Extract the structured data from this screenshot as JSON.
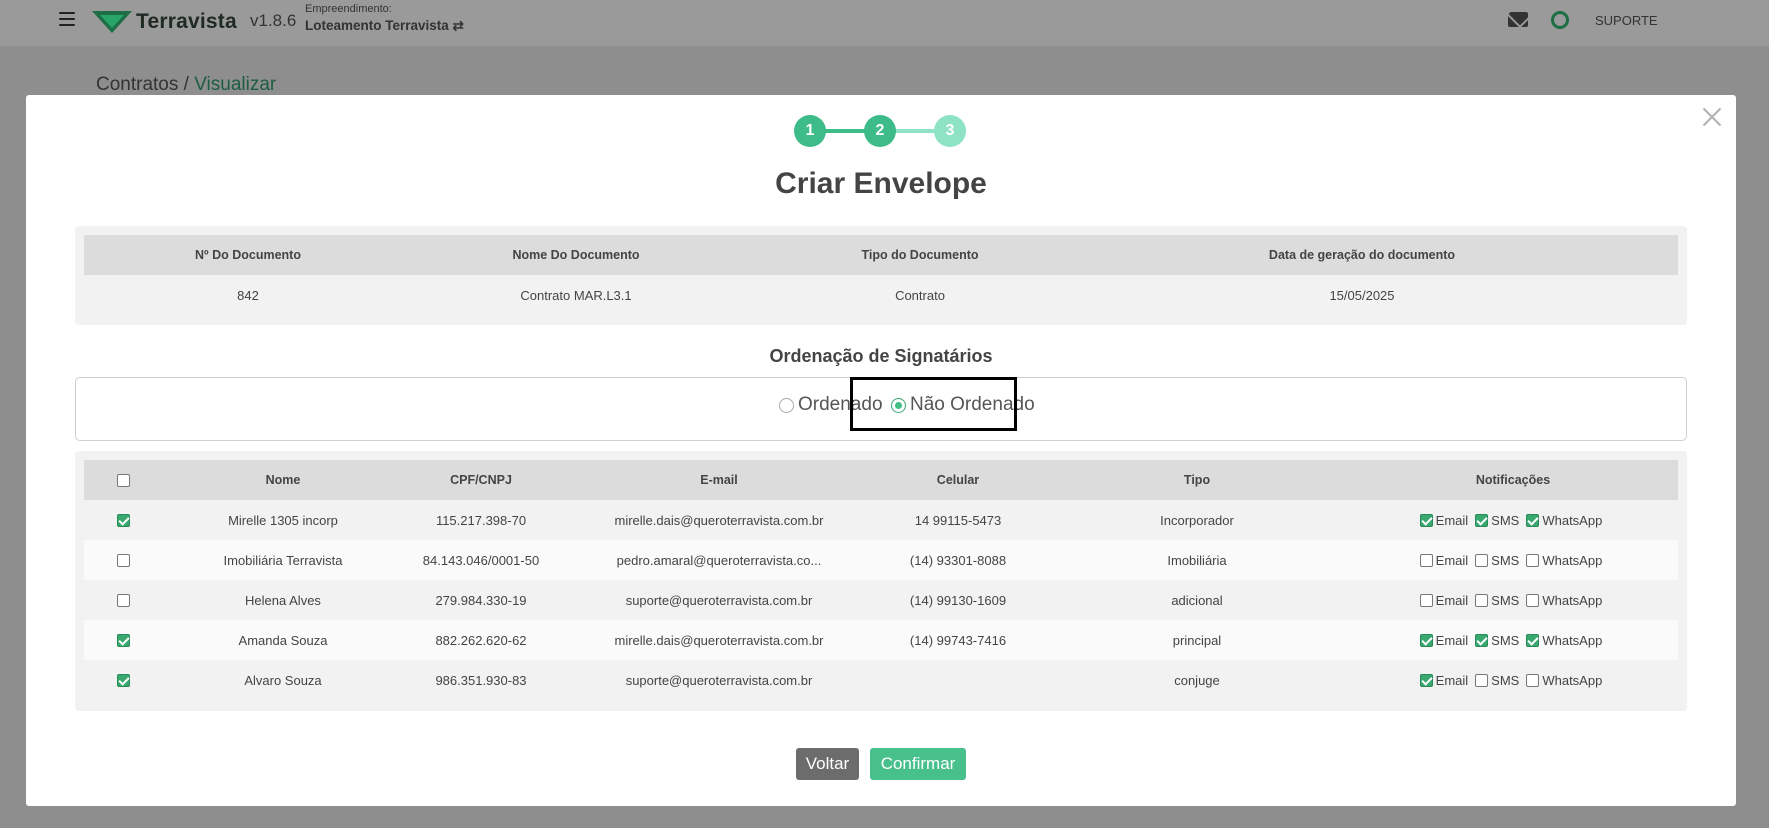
{
  "app": {
    "brand": "Terravista",
    "version": "v1.8.6",
    "enterprise_label": "Empreendimento:",
    "enterprise_value": "Loteamento Terravista ⇄",
    "support_label": "SUPORTE",
    "brand_color": "#1d6e45"
  },
  "breadcrumb": {
    "root": "Contratos",
    "separator": " / ",
    "current": "Visualizar"
  },
  "modal": {
    "steps": [
      "1",
      "2",
      "3"
    ],
    "current_step": 2,
    "title": "Criar Envelope"
  },
  "document_table": {
    "headers": [
      "Nº Do Documento",
      "Nome Do Documento",
      "Tipo do Documento",
      "Data de geração do documento"
    ],
    "row": [
      "842",
      "Contrato MAR.L3.1",
      "Contrato",
      "15/05/2025"
    ]
  },
  "ordering": {
    "title": "Ordenação de Signatários",
    "options": [
      {
        "label": "Ordenado",
        "selected": false
      },
      {
        "label": "Não Ordenado",
        "selected": true
      }
    ]
  },
  "signers_table": {
    "headers": [
      "Nome",
      "CPF/CNPJ",
      "E-mail",
      "Celular",
      "Tipo",
      "Notificações"
    ],
    "notification_labels": [
      "Email",
      "SMS",
      "WhatsApp"
    ],
    "rows": [
      {
        "selected": true,
        "name": "Mirelle 1305 incorp",
        "doc": "115.217.398-70",
        "email": "mirelle.dais@queroterravista.com.br",
        "phone": "14 99115-5473",
        "type": "Incorporador",
        "notifications": [
          true,
          true,
          true
        ]
      },
      {
        "selected": false,
        "name": "Imobiliária Terravista",
        "doc": "84.143.046/0001-50",
        "email": "pedro.amaral@queroterravista.co...",
        "phone": "(14) 93301-8088",
        "type": "Imobiliária",
        "notifications": [
          false,
          false,
          false
        ]
      },
      {
        "selected": false,
        "name": "Helena Alves",
        "doc": "279.984.330-19",
        "email": "suporte@queroterravista.com.br",
        "phone": "(14) 99130-1609",
        "type": "adicional",
        "notifications": [
          false,
          false,
          false
        ]
      },
      {
        "selected": true,
        "name": "Amanda Souza",
        "doc": "882.262.620-62",
        "email": "mirelle.dais@queroterravista.com.br",
        "phone": "(14) 99743-7416",
        "type": "principal",
        "notifications": [
          true,
          true,
          true
        ]
      },
      {
        "selected": true,
        "name": "Alvaro Souza",
        "doc": "986.351.930-83",
        "email": "suporte@queroterravista.com.br",
        "phone": "",
        "type": "conjuge",
        "notifications": [
          true,
          false,
          false
        ]
      }
    ]
  },
  "buttons": {
    "back": "Voltar",
    "confirm": "Confirmar"
  },
  "colors": {
    "step_done": "#3dbb88",
    "step_pending": "#8ee3c4",
    "confirm": "#47c08c",
    "back": "#6c6c6c",
    "checkbox_on": "#38a86f"
  }
}
